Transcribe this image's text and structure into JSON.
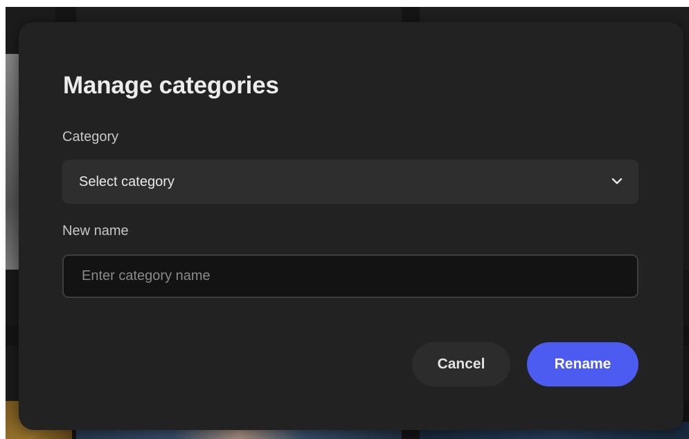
{
  "dialog": {
    "title": "Manage categories",
    "category_label": "Category",
    "category_select": {
      "selected_value": "Select category",
      "icon": "chevron-down-icon"
    },
    "new_name_label": "New name",
    "new_name_input": {
      "value": "",
      "placeholder": "Enter category name"
    },
    "buttons": {
      "cancel": "Cancel",
      "rename": "Rename"
    }
  },
  "colors": {
    "dialog_background": "#222222",
    "select_background": "#2e2e2e",
    "input_background": "#131313",
    "primary_accent": "#4c5cf0",
    "secondary_button": "#2c2c2c"
  }
}
